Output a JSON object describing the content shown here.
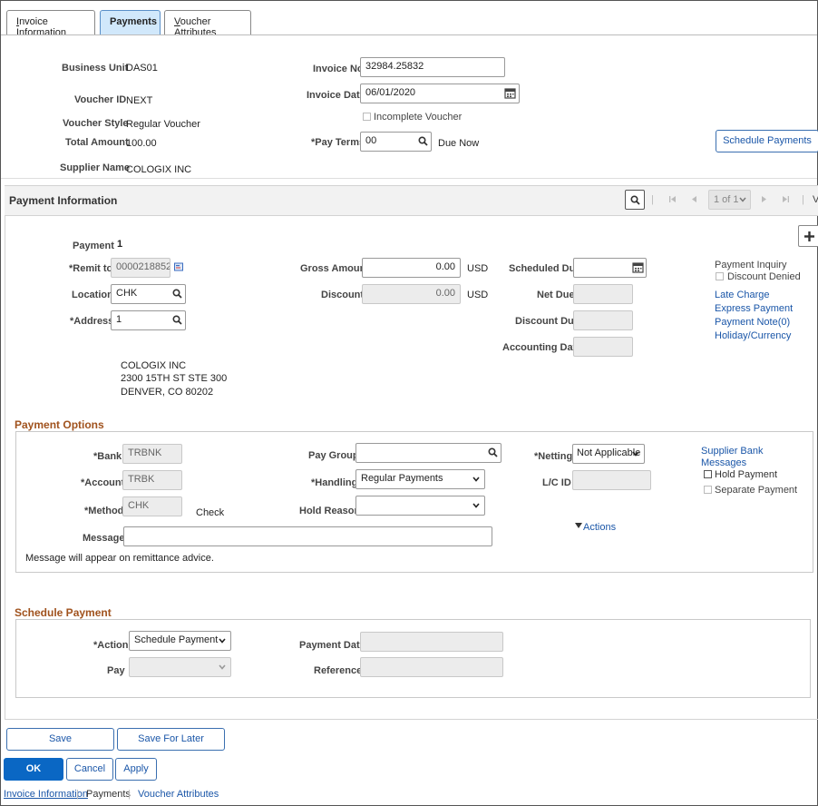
{
  "tabs": [
    {
      "label": "Invoice Information",
      "mnemonic": "I",
      "rest": "nvoice Information"
    },
    {
      "label": "Payments"
    },
    {
      "label": "Voucher Attributes",
      "mnemonic": "V",
      "rest": "oucher Attributes"
    }
  ],
  "header": {
    "business_unit_label": "Business Unit",
    "business_unit": "DAS01",
    "voucher_id_label": "Voucher ID",
    "voucher_id": "NEXT",
    "voucher_style_label": "Voucher Style",
    "voucher_style": "Regular Voucher",
    "total_amount_label": "Total Amount",
    "total_amount": "100.00",
    "supplier_name_label": "Supplier Name",
    "supplier_name": "COLOGIX INC",
    "invoice_no_label": "Invoice No",
    "invoice_no": "32984.25832",
    "invoice_date_label": "Invoice Date",
    "invoice_date": "06/01/2020",
    "incomplete_voucher_label": "Incomplete Voucher",
    "pay_terms_label": "*Pay Terms",
    "pay_terms": "00",
    "pay_terms_desc": "Due Now",
    "schedule_payments_button": "Schedule Payments"
  },
  "payment_info": {
    "title": "Payment Information",
    "pager": "1 of 1",
    "pager_end": "V",
    "payment_label": "Payment",
    "payment": "1",
    "remit_to_label": "*Remit to",
    "remit_to": "0000218852",
    "location_label": "Location",
    "location": "CHK",
    "address_label": "*Address",
    "address": "1",
    "address_lines": [
      "COLOGIX INC",
      "2300 15TH ST STE 300",
      "DENVER, CO  80202"
    ],
    "gross_amount_label": "Gross Amount",
    "gross_amount": "0.00",
    "gross_currency": "USD",
    "discount_label": "Discount",
    "discount": "0.00",
    "discount_currency": "USD",
    "scheduled_due_label": "Scheduled Due",
    "scheduled_due": "",
    "net_due_label": "Net Due",
    "discount_due_label": "Discount Due",
    "accounting_date_label": "Accounting Date",
    "payment_inquiry_label": "Payment Inquiry",
    "discount_denied_label": "Discount Denied",
    "links": [
      "Late Charge",
      "Express Payment",
      "Payment Note(0)",
      "Holiday/Currency"
    ]
  },
  "payment_options": {
    "title": "Payment Options",
    "bank_label": "*Bank",
    "bank": "TRBNK",
    "account_label": "*Account",
    "account": "TRBK",
    "method_label": "*Method",
    "method": "CHK",
    "method_desc": "Check",
    "message_label": "Message",
    "message": "",
    "message_note": "Message will appear on remittance advice.",
    "pay_group_label": "Pay Group",
    "pay_group": "",
    "handling_label": "*Handling",
    "handling": "Regular Payments",
    "hold_reason_label": "Hold Reason",
    "hold_reason": "",
    "netting_label": "*Netting",
    "netting": "Not Applicable",
    "lc_id_label": "L/C ID",
    "supplier_bank_link_1": "Supplier Bank",
    "supplier_bank_link_2": "Messages",
    "hold_payment_label": "Hold Payment",
    "separate_payment_label": "Separate Payment",
    "actions_label": "Actions"
  },
  "schedule_payment": {
    "title": "Schedule Payment",
    "action_label": "*Action",
    "action": "Schedule Payment",
    "pay_label": "Pay",
    "pay": "",
    "payment_date_label": "Payment Date",
    "reference_label": "Reference"
  },
  "footer": {
    "save": "Save",
    "save_for_later": "Save For Later",
    "ok": "OK",
    "cancel": "Cancel",
    "apply": "Apply",
    "links": [
      "Invoice Information",
      "Payments",
      "Voucher Attributes"
    ],
    "sep": "|"
  },
  "colors": {
    "accent": "#0a67c4",
    "link": "#1a56a8",
    "section_title": "#a0521d",
    "active_tab": "#d1e8fb"
  }
}
